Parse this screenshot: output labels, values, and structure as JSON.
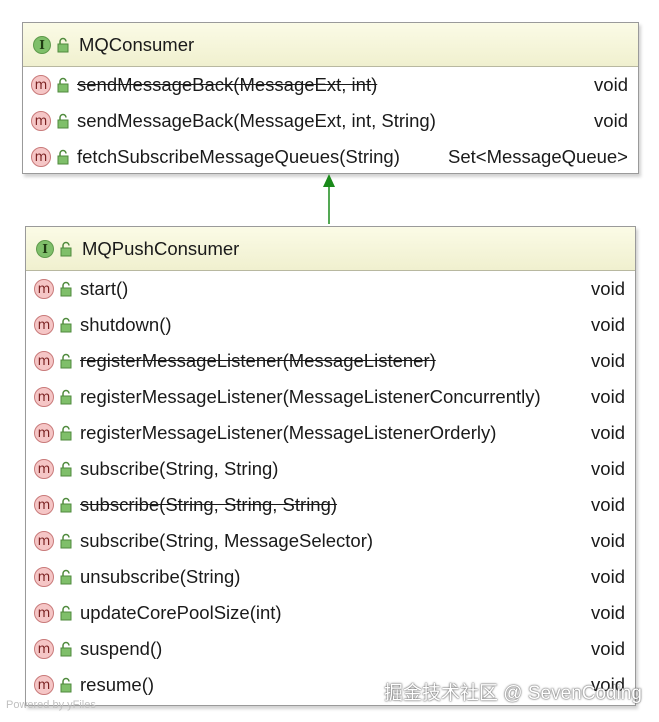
{
  "consumer": {
    "title": "MQConsumer",
    "methods": [
      {
        "signature": "sendMessageBack(MessageExt, int)",
        "return": "void",
        "deprecated": true
      },
      {
        "signature": "sendMessageBack(MessageExt, int, String)",
        "return": "void",
        "deprecated": false
      },
      {
        "signature": "fetchSubscribeMessageQueues(String)",
        "return": "Set<MessageQueue>",
        "deprecated": false
      }
    ]
  },
  "push_consumer": {
    "title": "MQPushConsumer",
    "methods": [
      {
        "signature": "start()",
        "return": "void",
        "deprecated": false
      },
      {
        "signature": "shutdown()",
        "return": "void",
        "deprecated": false
      },
      {
        "signature": "registerMessageListener(MessageListener)",
        "return": "void",
        "deprecated": true
      },
      {
        "signature": "registerMessageListener(MessageListenerConcurrently)",
        "return": "void",
        "deprecated": false
      },
      {
        "signature": "registerMessageListener(MessageListenerOrderly)",
        "return": "void",
        "deprecated": false
      },
      {
        "signature": "subscribe(String, String)",
        "return": "void",
        "deprecated": false
      },
      {
        "signature": "subscribe(String, String, String)",
        "return": "void",
        "deprecated": true
      },
      {
        "signature": "subscribe(String, MessageSelector)",
        "return": "void",
        "deprecated": false
      },
      {
        "signature": "unsubscribe(String)",
        "return": "void",
        "deprecated": false
      },
      {
        "signature": "updateCorePoolSize(int)",
        "return": "void",
        "deprecated": false
      },
      {
        "signature": "suspend()",
        "return": "void",
        "deprecated": false
      },
      {
        "signature": "resume()",
        "return": "void",
        "deprecated": false
      }
    ]
  },
  "icons": {
    "interface_letter": "I",
    "method_letter": "m"
  },
  "colors": {
    "arrow": "#1a8a1a",
    "header": "#f5f5dc"
  },
  "footer": {
    "powered_by": "Powered by yFiles",
    "watermark": "掘金技术社区 @ SevenCoding"
  }
}
